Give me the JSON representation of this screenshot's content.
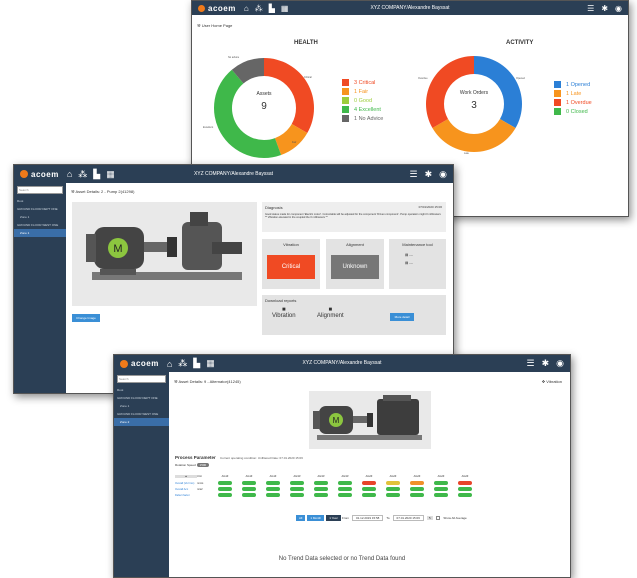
{
  "brand": {
    "name": "acoem",
    "accent": "#f07a1a",
    "topbar_color": "#2b3f55"
  },
  "company": "XYZ COMPANY/Alexandre Bayssat",
  "nav_icons": [
    "home-icon",
    "network-icon",
    "report-icon",
    "calendar-icon"
  ],
  "right_icons": [
    "menu-icon",
    "settings-icon",
    "user-icon"
  ],
  "window1": {
    "breadcrumb": "User Home Page",
    "health": {
      "title": "HEALTH",
      "center_label": "Assets",
      "center_value": "9",
      "segments": [
        {
          "label": "3 Critical",
          "value": 3,
          "color": "#f04a23"
        },
        {
          "label": "1 Fair",
          "value": 1,
          "color": "#f7941d"
        },
        {
          "label": "0 Good",
          "value": 0,
          "color": "#9ccd3b"
        },
        {
          "label": "4 Excellent",
          "value": 4,
          "color": "#3fb84a"
        },
        {
          "label": "1 No Advice",
          "value": 1,
          "color": "#666666"
        }
      ],
      "segment_labels": [
        "Critical",
        "Fair",
        "Excellent",
        "No advice"
      ]
    },
    "activity": {
      "title": "ACTIVITY",
      "center_label": "Work Orders",
      "center_value": "3",
      "segments": [
        {
          "label": "1 Opened",
          "value": 1,
          "color": "#2b7fd6"
        },
        {
          "label": "1 Late",
          "value": 1,
          "color": "#f7941d"
        },
        {
          "label": "1 Overdue",
          "value": 1,
          "color": "#f04a23"
        },
        {
          "label": "0 Closed",
          "value": 0,
          "color": "#3fb84a"
        }
      ],
      "segment_labels": [
        "Opened",
        "Late",
        "Overdue"
      ]
    }
  },
  "window2": {
    "breadcrumb": "Asset Details: 2 - Pump 2(41298)",
    "sidebar": {
      "search_placeholder": "Search",
      "items": [
        "Root",
        "GROUND FLOOR DEPT ONE",
        "Zone 1",
        "GROUND FLOOR WEST ONE",
        "Zone 1"
      ]
    },
    "change_image_label": "Change Image",
    "diagnosis": {
      "title": "Diagnosis",
      "date": "07/01/2020 15:06",
      "text": "Good status made for component 'Electric motor'. Correctable will be adjusted for the component 'Driven component'. Pump operation might 0 millimeters ** Vibration elevated in the coupled the 0 millimeters **"
    },
    "vibration": {
      "title": "Vibration",
      "status": "Critical",
      "color": "#f04a23"
    },
    "alignment": {
      "title": "Alignment",
      "status": "Unknown",
      "color": "#777777"
    },
    "maintenance": {
      "title": "Maintenance tool",
      "rows": [
        "---",
        "---"
      ]
    },
    "download": {
      "title": "Download reports",
      "items": [
        "Vibration",
        "Alignment"
      ],
      "button": "More detail"
    }
  },
  "window3": {
    "breadcrumb": "Asset Details: 9 - Alternator(41245)",
    "vibration_link": "Vibration",
    "sidebar": {
      "search_placeholder": "Search",
      "items": [
        "Root",
        "GROUND FLOOR DEPT ONE",
        "Zone 1",
        "GROUND FLOOR WEST ONE",
        "Zone 2"
      ]
    },
    "process_title": "Process Parameter",
    "process_sub": "Current operating condition: Unfiltered  Date: 07.01.2020 15:06",
    "rotation_speed_label": "Rotation Speed",
    "rotation_speed_value": "1500",
    "columns": [
      "Unit",
      "AG1Z",
      "AG1Z",
      "AG1Z",
      "AG1R",
      "AG1R",
      "AG1R",
      "AG2Z",
      "AG2Z",
      "AG2Z",
      "AG2Z",
      "AG2Z"
    ],
    "rows": [
      {
        "name": "Overall (Vel rms)",
        "unit": "mm/s",
        "pills": [
          "g",
          "g",
          "g",
          "g",
          "g",
          "g",
          "r",
          "y",
          "o",
          "g",
          "r"
        ]
      },
      {
        "name": "Overall Acc",
        "unit": "m/s2",
        "pills": [
          "g",
          "g",
          "g",
          "g",
          "g",
          "g",
          "g",
          "g",
          "g",
          "g",
          "g"
        ]
      },
      {
        "name": "Defect factor",
        "unit": "",
        "pills": [
          "g",
          "g",
          "g",
          "g",
          "g",
          "g",
          "g",
          "g",
          "g",
          "g",
          "g"
        ]
      }
    ],
    "period_buttons": [
      "All",
      "1 Month",
      "1 Year"
    ],
    "from_label": "From",
    "from_value": "01.12.2019 15:58",
    "to_label": "To",
    "to_value": "07.01.2020 15:06",
    "show_average_label": "Show All Average",
    "empty_message": "No Trend Data selected or no Trend Data found"
  }
}
